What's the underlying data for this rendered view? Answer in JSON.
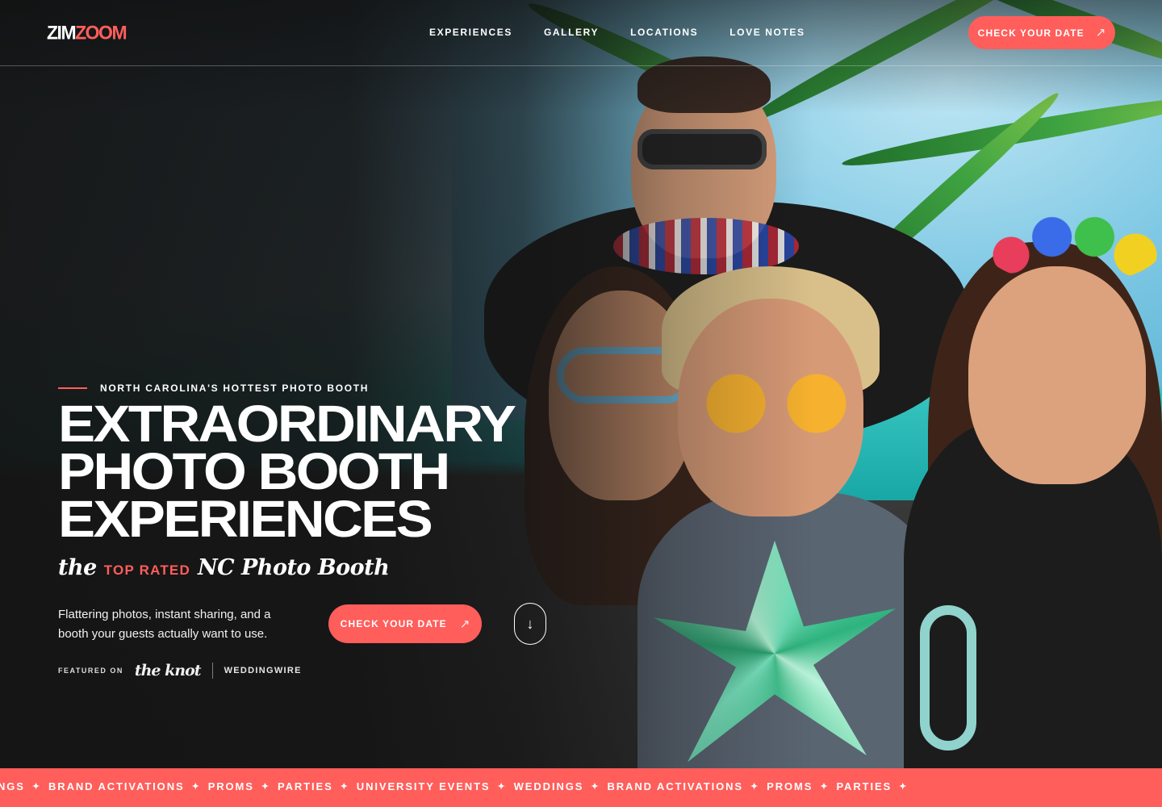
{
  "brand": {
    "logo_part1": "ZIM",
    "logo_part2": "ZOOM",
    "accent_color": "#ff5e5b"
  },
  "nav": {
    "items": [
      {
        "label": "EXPERIENCES"
      },
      {
        "label": "GALLERY"
      },
      {
        "label": "LOCATIONS"
      },
      {
        "label": "LOVE NOTES"
      }
    ],
    "cta_label": "CHECK YOUR DATE",
    "cta_icon": "arrow-up-right-icon"
  },
  "hero": {
    "kicker": "NORTH CAROLINA'S HOTTEST PHOTO BOOTH",
    "headline_lines": [
      "EXTRAORDINARY",
      "PHOTO BOOTH",
      "EXPERIENCES"
    ],
    "tagline": {
      "script_prefix": "the",
      "caps": "TOP RATED",
      "script_suffix": "NC Photo Booth"
    },
    "description": "Flattering photos, instant sharing, and a booth your guests actually want to use.",
    "cta_label": "CHECK YOUR DATE",
    "cta_icon": "arrow-up-right-icon",
    "scroll_icon": "arrow-down-icon",
    "featured_label": "FEATURED ON",
    "featured_logos": [
      "the knot",
      "WEDDINGWIRE"
    ]
  },
  "marquee": {
    "items": [
      "NGS",
      "BRAND ACTIVATIONS",
      "PROMS",
      "PARTIES",
      "UNIVERSITY EVENTS",
      "WEDDINGS",
      "BRAND ACTIVATIONS",
      "PROMS",
      "PARTIES"
    ],
    "separator_icon": "sparkle-star-icon"
  }
}
